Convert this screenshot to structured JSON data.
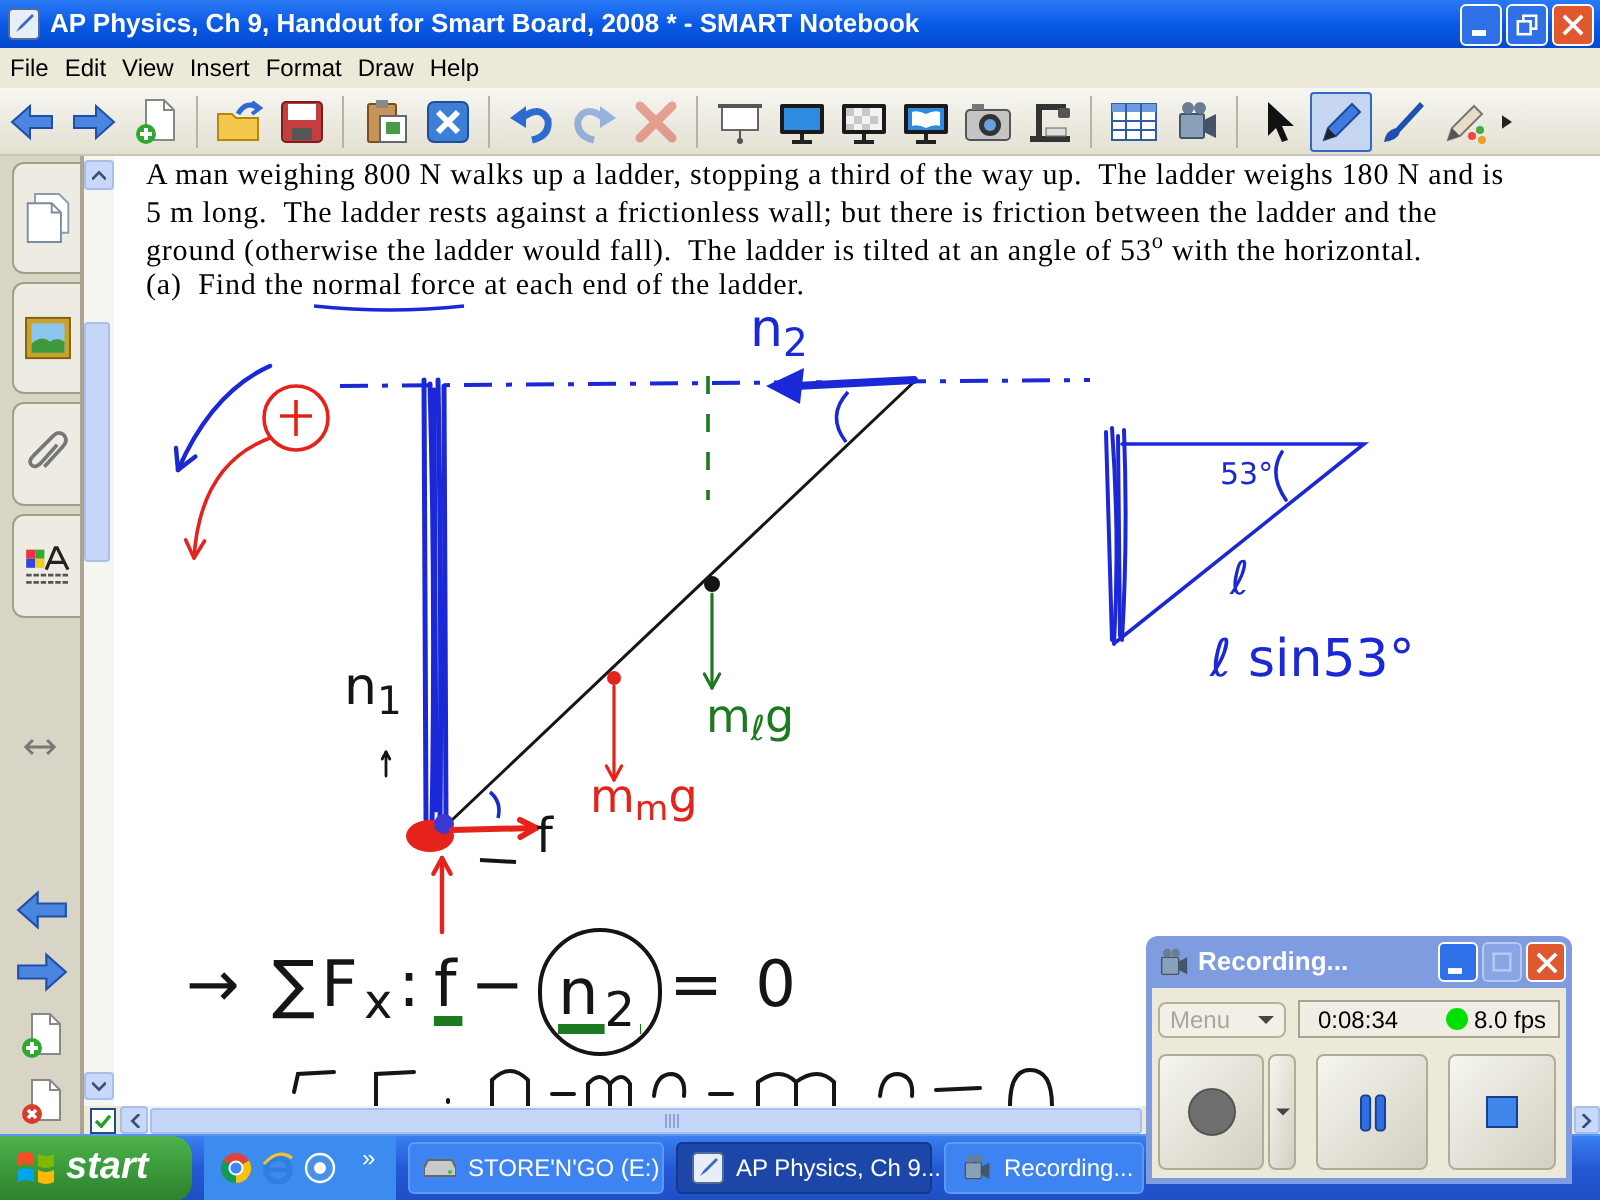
{
  "window": {
    "title": "AP Physics, Ch 9, Handout for Smart Board, 2008 * - SMART Notebook"
  },
  "menu": [
    "File",
    "Edit",
    "View",
    "Insert",
    "Format",
    "Draw",
    "Help"
  ],
  "toolbar": {
    "buttons": [
      {
        "disabled": false
      },
      {
        "disabled": false
      },
      {
        "disabled": false
      },
      {
        "disabled": false
      },
      {
        "disabled": false
      },
      {
        "disabled": false
      },
      {
        "disabled": false
      },
      {
        "disabled": false
      },
      {
        "disabled": true
      },
      {
        "disabled": true
      },
      {
        "disabled": false
      },
      {
        "disabled": false
      },
      {
        "disabled": false
      },
      {
        "disabled": false
      },
      {
        "disabled": false
      },
      {
        "disabled": false
      },
      {
        "disabled": false
      },
      {
        "disabled": false
      }
    ],
    "tools": [
      {
        "selected": false
      },
      {
        "selected": true
      },
      {
        "selected": false
      },
      {
        "selected": false
      }
    ]
  },
  "page": {
    "problem_lines": [
      "A man weighing 800 N walks up a ladder, stopping a third of the way up.  The ladder weighs 180 N and is",
      "5 m long.  The ladder rests against a frictionless wall; but there is friction between the ladder and the",
      "ground (otherwise the ladder would fall).  The ladder is tilted at an angle of 53$^{o}$ with the horizontal.",
      "(a)  Find the normal force at each end of the ladder."
    ],
    "ink_labels": [
      {
        "text": "n$_{2}$",
        "color": "#1b28d8"
      },
      {
        "text": "n$_{1}$",
        "color": "#151515"
      },
      {
        "text": "m$_{ℓ}$g",
        "color": "#1d7a20"
      },
      {
        "text": "m$_{m}$g",
        "color": "#e5231b"
      },
      {
        "text": "f",
        "color": "#151515"
      },
      {
        "text": "53°",
        "color": "#1b28d8"
      },
      {
        "text": "ℓ",
        "color": "#1b28d8"
      },
      {
        "text": "ℓ sin53°",
        "color": "#1b28d8"
      }
    ],
    "equation": [
      {
        "text": "→ ∑F$_{x}$:",
        "underlined": false,
        "circled": false
      },
      {
        "text": "f",
        "underlined": true,
        "circled": false
      },
      {
        "text": "−",
        "underlined": false,
        "circled": false
      },
      {
        "text": "n$_{2}$",
        "underlined": true,
        "circled": true
      },
      {
        "text": "= 0",
        "underlined": false,
        "circled": false
      }
    ]
  },
  "page_checkbox": {
    "checked": true
  },
  "recording_window": {
    "title": "Recording...",
    "menu_button": {
      "label": "Menu",
      "disabled": true
    },
    "elapsed": "0:08:34",
    "status_dot": {
      "color": "#00e000"
    },
    "frame_rate": "8.0 fps"
  },
  "taskbar": {
    "start": "start",
    "overflow": "»",
    "tasks": [
      {
        "label": "STORE'N'GO (E:)",
        "selected": false
      },
      {
        "label": "AP Physics, Ch 9...",
        "selected": true
      },
      {
        "label": "Recording...",
        "selected": false
      }
    ]
  }
}
